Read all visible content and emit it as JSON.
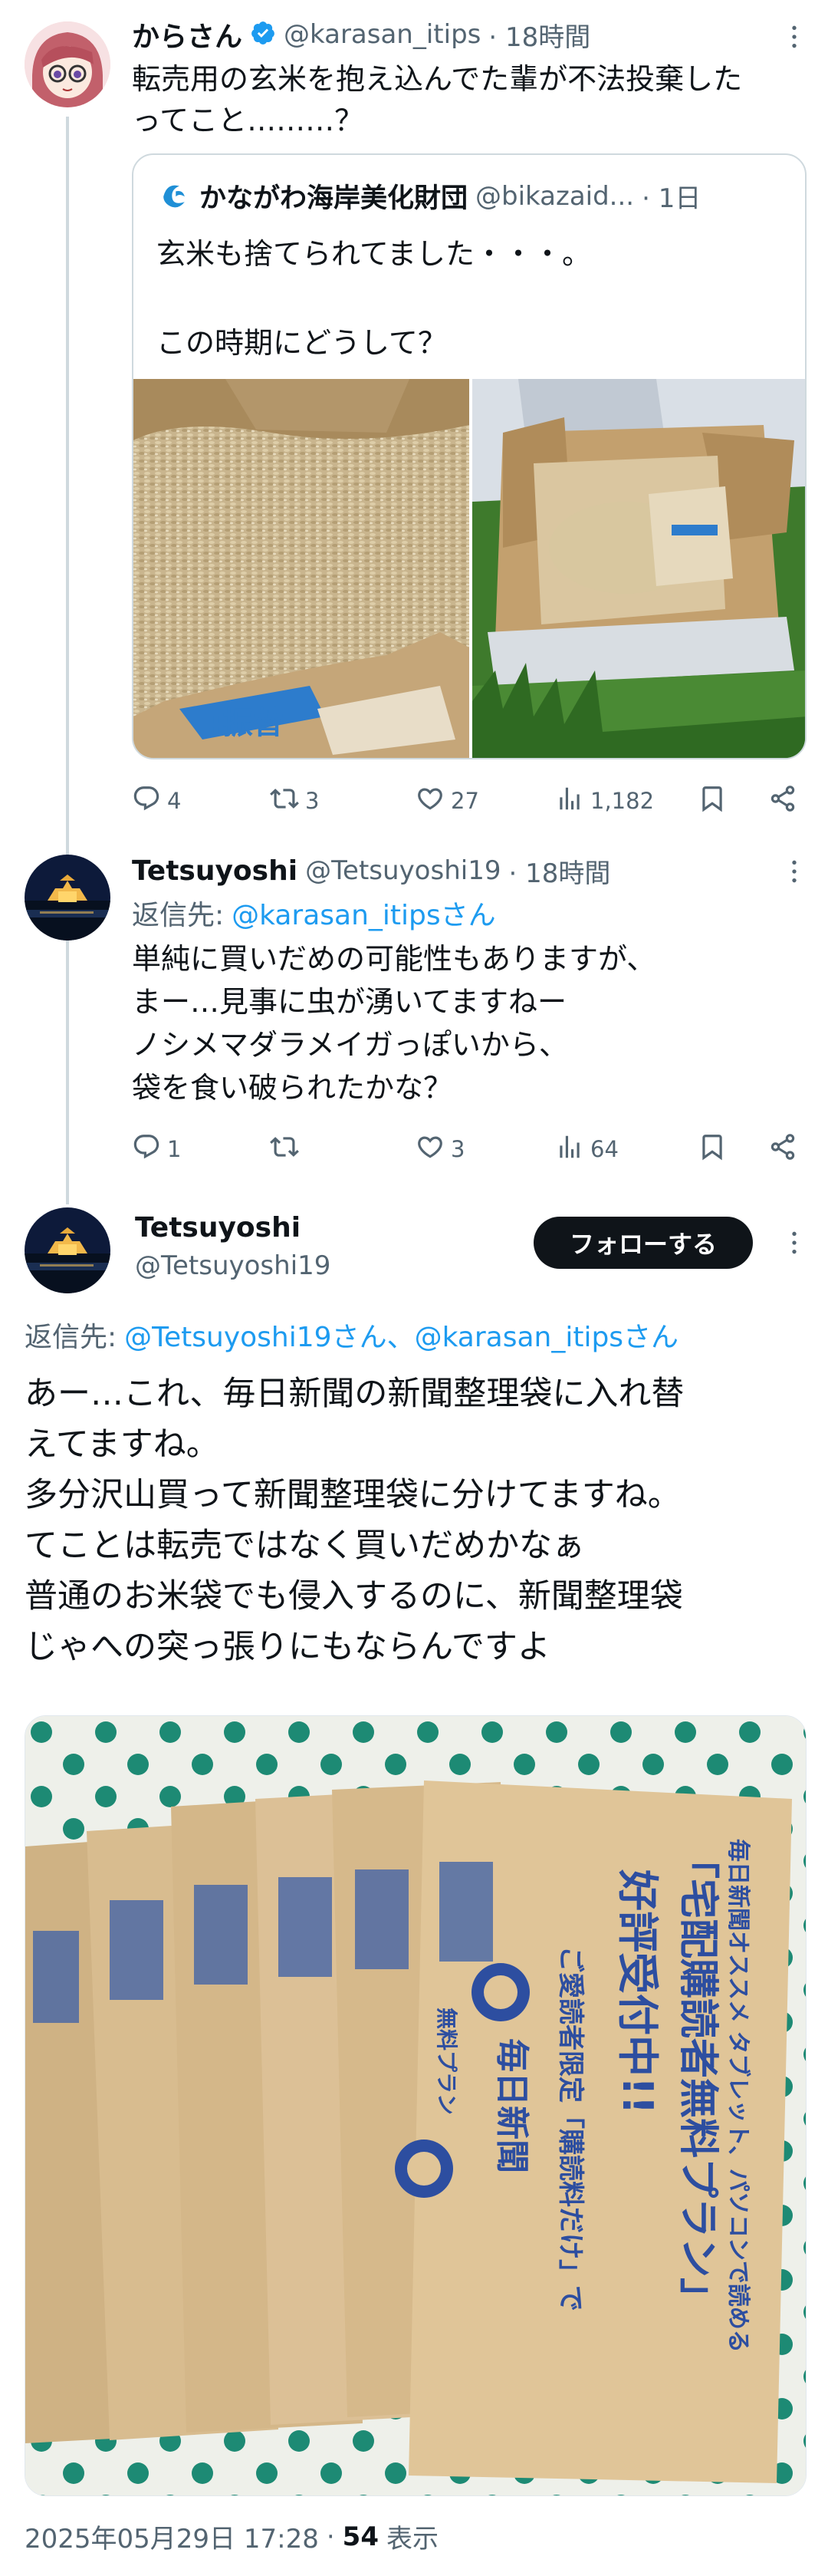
{
  "tweet1": {
    "name": "からさん",
    "handle": "@karasan_itips",
    "time": "· 18時間",
    "text": "転売用の玄米を抱え込んでた輩が不法投棄した\nってこと………？",
    "quote": {
      "name": "かながわ海岸美化財団",
      "handle": "@bikazaid...",
      "time": "· 1日",
      "text": "玄米も捨てられてました・・・。\n\nこの時期にどうして？"
    },
    "reply_count": "4",
    "retweet_count": "3",
    "like_count": "27",
    "view_count": "1,182"
  },
  "tweet2": {
    "name": "Tetsuyoshi",
    "handle": "@Tetsuyoshi19",
    "time": "· 18時間",
    "reply_to_label": "返信先:",
    "reply_to_handle": "@karasan_itipsさん",
    "text": "単純に買いだめの可能性もありますが、\nまー…見事に虫が湧いてますねー\nノシメマダラメイガっぽいから、\n袋を食い破られたかな？",
    "reply_count": "1",
    "retweet_count": "",
    "like_count": "3",
    "view_count": "64"
  },
  "tweet3": {
    "name": "Tetsuyoshi",
    "handle": "@Tetsuyoshi19",
    "follow_label": "フォローする",
    "reply_to_label": "返信先:",
    "reply_to_handles": "@Tetsuyoshi19さん、@karasan_itipsさん",
    "text": "あー…これ、毎日新聞の新聞整理袋に入れ替\nえてますね。\n多分沢山買って新聞整理袋に分けてますね。\nてことは転売ではなく買いだめかなぁ\n普通のお米袋でも侵入するのに、新聞整理袋\nじゃへの突っ張りにもならんですよ",
    "bag_text_lines": [
      "毎日新聞オススメ タブレット、パソコンで読める",
      "「宅配購読者無料プラン」",
      "好評受付中!!",
      "ご愛読者限定「購読料だけ」で",
      "毎日新聞",
      "無料プラン"
    ],
    "timestamp": "2025年05月29日 17:28",
    "views_count": "54",
    "views_label": "表示"
  },
  "icons": [
    "verified-badge-icon",
    "more-icon",
    "reply-icon",
    "retweet-icon",
    "like-icon",
    "views-icon",
    "bookmark-icon",
    "share-icon"
  ],
  "colors": {
    "accent": "#1d9bf0",
    "text": "#0f1419",
    "secondary": "#536471",
    "border": "#cfd9de",
    "follow_bg": "#0f1419"
  }
}
